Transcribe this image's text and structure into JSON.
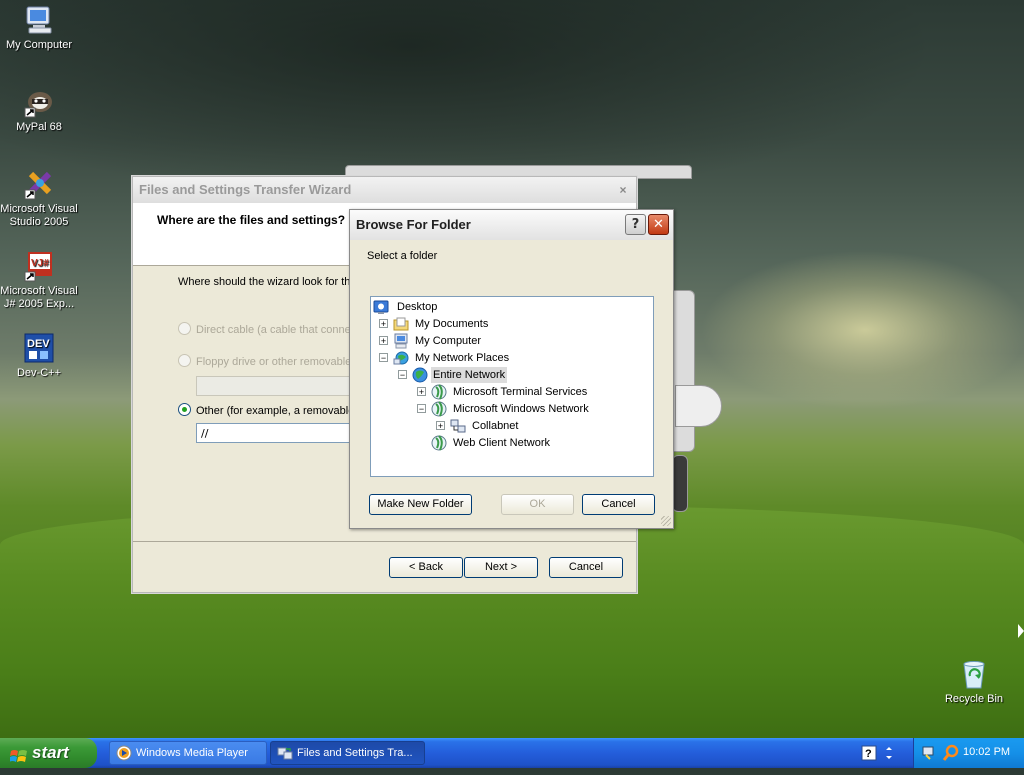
{
  "desktop": {
    "icons": [
      {
        "label": "My Computer",
        "icon": "my-computer-icon"
      },
      {
        "label": "MyPal 68",
        "icon": "mypal-icon"
      },
      {
        "label": "Microsoft Visual Studio 2005",
        "icon": "visual-studio-icon"
      },
      {
        "label": "Microsoft Visual J# 2005 Exp...",
        "icon": "visual-jsharp-icon"
      },
      {
        "label": "Dev-C++",
        "icon": "dev-cpp-icon"
      },
      {
        "label": "Recycle Bin",
        "icon": "recycle-bin-icon"
      }
    ]
  },
  "wizard": {
    "title": "Files and Settings Transfer Wizard",
    "question": "Where are the files and settings?",
    "prompt": "Where should the wizard look for the",
    "options": [
      {
        "label": "Direct cable (a cable that conne",
        "selected": false,
        "enabled": false
      },
      {
        "label": "Floppy drive or other removable m",
        "selected": false,
        "enabled": false
      },
      {
        "label": "Other (for example, a removable d",
        "selected": true,
        "enabled": true
      }
    ],
    "other_path": "//",
    "buttons": {
      "back": "< Back",
      "next": "Next >",
      "cancel": "Cancel"
    }
  },
  "browse": {
    "title": "Browse For Folder",
    "help_glyph": "?",
    "close_glyph": "✕",
    "label": "Select a folder",
    "tree": [
      {
        "label": "Desktop",
        "icon": "desktop-icon",
        "expander": ""
      },
      {
        "label": "My Documents",
        "icon": "folder-icon",
        "expander": "+"
      },
      {
        "label": "My Computer",
        "icon": "computer-icon",
        "expander": "+"
      },
      {
        "label": "My Network Places",
        "icon": "network-places-icon",
        "expander": "−"
      },
      {
        "label": "Entire Network",
        "icon": "globe-icon",
        "expander": "−",
        "selected": true
      },
      {
        "label": "Microsoft Terminal Services",
        "icon": "globe-icon",
        "expander": "+"
      },
      {
        "label": "Microsoft Windows Network",
        "icon": "globe-icon",
        "expander": "−"
      },
      {
        "label": "Collabnet",
        "icon": "workgroup-icon",
        "expander": "+"
      },
      {
        "label": "Web Client Network",
        "icon": "globe-icon",
        "expander": ""
      }
    ],
    "buttons": {
      "new_folder": "Make New Folder",
      "ok": "OK",
      "cancel": "Cancel"
    }
  },
  "taskbar": {
    "start_label": "start",
    "tasks": [
      {
        "label": "Windows Media Player",
        "icon": "media-player-icon",
        "active": false
      },
      {
        "label": "Files and Settings Tra...",
        "icon": "transfer-wizard-icon",
        "active": true
      }
    ],
    "clock": "10:02 PM"
  },
  "colors": {
    "taskbar_blue": "#245edb",
    "start_green": "#3c9a38",
    "dialog_face": "#ece9d8",
    "close_red": "#c23a14"
  }
}
